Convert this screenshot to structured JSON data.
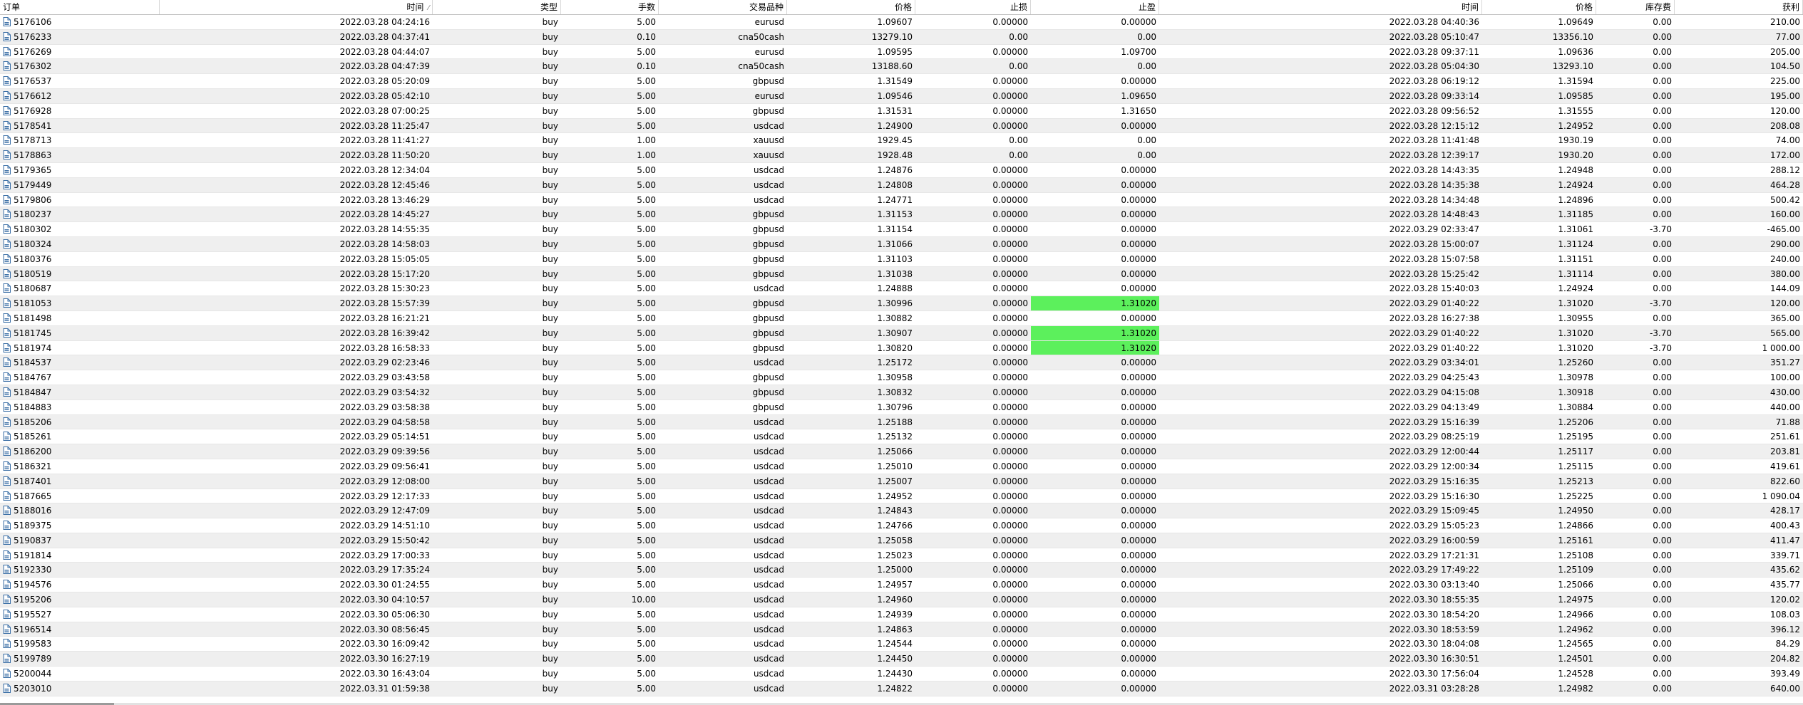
{
  "columns": {
    "order": "订单",
    "open_time": "时间",
    "type": "类型",
    "lots": "手数",
    "symbol": "交易品种",
    "open_price": "价格",
    "sl": "止损",
    "tp": "止盈",
    "close_time": "时间",
    "close_price": "价格",
    "swap": "库存费",
    "profit": "获利"
  },
  "icons": {
    "order_row": "document-icon",
    "sort": "sort-indicator-icon"
  },
  "colors": {
    "highlight": "#5cf05c",
    "row_alt": "#efefef"
  },
  "rows": [
    [
      "5176106",
      "2022.03.28 04:24:16",
      "buy",
      "5.00",
      "eurusd",
      "1.09607",
      "0.00000",
      "0.00000",
      "2022.03.28 04:40:36",
      "1.09649",
      "0.00",
      "210.00"
    ],
    [
      "5176233",
      "2022.03.28 04:37:41",
      "buy",
      "0.10",
      "cna50cash",
      "13279.10",
      "0.00",
      "0.00",
      "2022.03.28 05:10:47",
      "13356.10",
      "0.00",
      "77.00"
    ],
    [
      "5176269",
      "2022.03.28 04:44:07",
      "buy",
      "5.00",
      "eurusd",
      "1.09595",
      "0.00000",
      "1.09700",
      "2022.03.28 09:37:11",
      "1.09636",
      "0.00",
      "205.00"
    ],
    [
      "5176302",
      "2022.03.28 04:47:39",
      "buy",
      "0.10",
      "cna50cash",
      "13188.60",
      "0.00",
      "0.00",
      "2022.03.28 05:04:30",
      "13293.10",
      "0.00",
      "104.50"
    ],
    [
      "5176537",
      "2022.03.28 05:20:09",
      "buy",
      "5.00",
      "gbpusd",
      "1.31549",
      "0.00000",
      "0.00000",
      "2022.03.28 06:19:12",
      "1.31594",
      "0.00",
      "225.00"
    ],
    [
      "5176612",
      "2022.03.28 05:42:10",
      "buy",
      "5.00",
      "eurusd",
      "1.09546",
      "0.00000",
      "1.09650",
      "2022.03.28 09:33:14",
      "1.09585",
      "0.00",
      "195.00"
    ],
    [
      "5176928",
      "2022.03.28 07:00:25",
      "buy",
      "5.00",
      "gbpusd",
      "1.31531",
      "0.00000",
      "1.31650",
      "2022.03.28 09:56:52",
      "1.31555",
      "0.00",
      "120.00"
    ],
    [
      "5178541",
      "2022.03.28 11:25:47",
      "buy",
      "5.00",
      "usdcad",
      "1.24900",
      "0.00000",
      "0.00000",
      "2022.03.28 12:15:12",
      "1.24952",
      "0.00",
      "208.08"
    ],
    [
      "5178713",
      "2022.03.28 11:41:27",
      "buy",
      "1.00",
      "xauusd",
      "1929.45",
      "0.00",
      "0.00",
      "2022.03.28 11:41:48",
      "1930.19",
      "0.00",
      "74.00"
    ],
    [
      "5178863",
      "2022.03.28 11:50:20",
      "buy",
      "1.00",
      "xauusd",
      "1928.48",
      "0.00",
      "0.00",
      "2022.03.28 12:39:17",
      "1930.20",
      "0.00",
      "172.00"
    ],
    [
      "5179365",
      "2022.03.28 12:34:04",
      "buy",
      "5.00",
      "usdcad",
      "1.24876",
      "0.00000",
      "0.00000",
      "2022.03.28 14:43:35",
      "1.24948",
      "0.00",
      "288.12"
    ],
    [
      "5179449",
      "2022.03.28 12:45:46",
      "buy",
      "5.00",
      "usdcad",
      "1.24808",
      "0.00000",
      "0.00000",
      "2022.03.28 14:35:38",
      "1.24924",
      "0.00",
      "464.28"
    ],
    [
      "5179806",
      "2022.03.28 13:46:29",
      "buy",
      "5.00",
      "usdcad",
      "1.24771",
      "0.00000",
      "0.00000",
      "2022.03.28 14:34:48",
      "1.24896",
      "0.00",
      "500.42"
    ],
    [
      "5180237",
      "2022.03.28 14:45:27",
      "buy",
      "5.00",
      "gbpusd",
      "1.31153",
      "0.00000",
      "0.00000",
      "2022.03.28 14:48:43",
      "1.31185",
      "0.00",
      "160.00"
    ],
    [
      "5180302",
      "2022.03.28 14:55:35",
      "buy",
      "5.00",
      "gbpusd",
      "1.31154",
      "0.00000",
      "0.00000",
      "2022.03.29 02:33:47",
      "1.31061",
      "-3.70",
      "-465.00"
    ],
    [
      "5180324",
      "2022.03.28 14:58:03",
      "buy",
      "5.00",
      "gbpusd",
      "1.31066",
      "0.00000",
      "0.00000",
      "2022.03.28 15:00:07",
      "1.31124",
      "0.00",
      "290.00"
    ],
    [
      "5180376",
      "2022.03.28 15:05:05",
      "buy",
      "5.00",
      "gbpusd",
      "1.31103",
      "0.00000",
      "0.00000",
      "2022.03.28 15:07:58",
      "1.31151",
      "0.00",
      "240.00"
    ],
    [
      "5180519",
      "2022.03.28 15:17:20",
      "buy",
      "5.00",
      "gbpusd",
      "1.31038",
      "0.00000",
      "0.00000",
      "2022.03.28 15:25:42",
      "1.31114",
      "0.00",
      "380.00"
    ],
    [
      "5180687",
      "2022.03.28 15:30:23",
      "buy",
      "5.00",
      "usdcad",
      "1.24888",
      "0.00000",
      "0.00000",
      "2022.03.28 15:40:03",
      "1.24924",
      "0.00",
      "144.09"
    ],
    [
      "5181053",
      "2022.03.28 15:57:39",
      "buy",
      "5.00",
      "gbpusd",
      "1.30996",
      "0.00000",
      "1.31020",
      "2022.03.29 01:40:22",
      "1.31020",
      "-3.70",
      "120.00"
    ],
    [
      "5181498",
      "2022.03.28 16:21:21",
      "buy",
      "5.00",
      "gbpusd",
      "1.30882",
      "0.00000",
      "0.00000",
      "2022.03.28 16:27:38",
      "1.30955",
      "0.00",
      "365.00"
    ],
    [
      "5181745",
      "2022.03.28 16:39:42",
      "buy",
      "5.00",
      "gbpusd",
      "1.30907",
      "0.00000",
      "1.31020",
      "2022.03.29 01:40:22",
      "1.31020",
      "-3.70",
      "565.00"
    ],
    [
      "5181974",
      "2022.03.28 16:58:33",
      "buy",
      "5.00",
      "gbpusd",
      "1.30820",
      "0.00000",
      "1.31020",
      "2022.03.29 01:40:22",
      "1.31020",
      "-3.70",
      "1 000.00"
    ],
    [
      "5184537",
      "2022.03.29 02:23:46",
      "buy",
      "5.00",
      "usdcad",
      "1.25172",
      "0.00000",
      "0.00000",
      "2022.03.29 03:34:01",
      "1.25260",
      "0.00",
      "351.27"
    ],
    [
      "5184767",
      "2022.03.29 03:43:58",
      "buy",
      "5.00",
      "gbpusd",
      "1.30958",
      "0.00000",
      "0.00000",
      "2022.03.29 04:25:43",
      "1.30978",
      "0.00",
      "100.00"
    ],
    [
      "5184847",
      "2022.03.29 03:54:32",
      "buy",
      "5.00",
      "gbpusd",
      "1.30832",
      "0.00000",
      "0.00000",
      "2022.03.29 04:15:08",
      "1.30918",
      "0.00",
      "430.00"
    ],
    [
      "5184883",
      "2022.03.29 03:58:38",
      "buy",
      "5.00",
      "gbpusd",
      "1.30796",
      "0.00000",
      "0.00000",
      "2022.03.29 04:13:49",
      "1.30884",
      "0.00",
      "440.00"
    ],
    [
      "5185206",
      "2022.03.29 04:58:58",
      "buy",
      "5.00",
      "usdcad",
      "1.25188",
      "0.00000",
      "0.00000",
      "2022.03.29 15:16:39",
      "1.25206",
      "0.00",
      "71.88"
    ],
    [
      "5185261",
      "2022.03.29 05:14:51",
      "buy",
      "5.00",
      "usdcad",
      "1.25132",
      "0.00000",
      "0.00000",
      "2022.03.29 08:25:19",
      "1.25195",
      "0.00",
      "251.61"
    ],
    [
      "5186200",
      "2022.03.29 09:39:56",
      "buy",
      "5.00",
      "usdcad",
      "1.25066",
      "0.00000",
      "0.00000",
      "2022.03.29 12:00:44",
      "1.25117",
      "0.00",
      "203.81"
    ],
    [
      "5186321",
      "2022.03.29 09:56:41",
      "buy",
      "5.00",
      "usdcad",
      "1.25010",
      "0.00000",
      "0.00000",
      "2022.03.29 12:00:34",
      "1.25115",
      "0.00",
      "419.61"
    ],
    [
      "5187401",
      "2022.03.29 12:08:00",
      "buy",
      "5.00",
      "usdcad",
      "1.25007",
      "0.00000",
      "0.00000",
      "2022.03.29 15:16:35",
      "1.25213",
      "0.00",
      "822.60"
    ],
    [
      "5187665",
      "2022.03.29 12:17:33",
      "buy",
      "5.00",
      "usdcad",
      "1.24952",
      "0.00000",
      "0.00000",
      "2022.03.29 15:16:30",
      "1.25225",
      "0.00",
      "1 090.04"
    ],
    [
      "5188016",
      "2022.03.29 12:47:09",
      "buy",
      "5.00",
      "usdcad",
      "1.24843",
      "0.00000",
      "0.00000",
      "2022.03.29 15:09:45",
      "1.24950",
      "0.00",
      "428.17"
    ],
    [
      "5189375",
      "2022.03.29 14:51:10",
      "buy",
      "5.00",
      "usdcad",
      "1.24766",
      "0.00000",
      "0.00000",
      "2022.03.29 15:05:23",
      "1.24866",
      "0.00",
      "400.43"
    ],
    [
      "5190837",
      "2022.03.29 15:50:42",
      "buy",
      "5.00",
      "usdcad",
      "1.25058",
      "0.00000",
      "0.00000",
      "2022.03.29 16:00:59",
      "1.25161",
      "0.00",
      "411.47"
    ],
    [
      "5191814",
      "2022.03.29 17:00:33",
      "buy",
      "5.00",
      "usdcad",
      "1.25023",
      "0.00000",
      "0.00000",
      "2022.03.29 17:21:31",
      "1.25108",
      "0.00",
      "339.71"
    ],
    [
      "5192330",
      "2022.03.29 17:35:24",
      "buy",
      "5.00",
      "usdcad",
      "1.25000",
      "0.00000",
      "0.00000",
      "2022.03.29 17:49:22",
      "1.25109",
      "0.00",
      "435.62"
    ],
    [
      "5194576",
      "2022.03.30 01:24:55",
      "buy",
      "5.00",
      "usdcad",
      "1.24957",
      "0.00000",
      "0.00000",
      "2022.03.30 03:13:40",
      "1.25066",
      "0.00",
      "435.77"
    ],
    [
      "5195206",
      "2022.03.30 04:10:57",
      "buy",
      "10.00",
      "usdcad",
      "1.24960",
      "0.00000",
      "0.00000",
      "2022.03.30 18:55:35",
      "1.24975",
      "0.00",
      "120.02"
    ],
    [
      "5195527",
      "2022.03.30 05:06:30",
      "buy",
      "5.00",
      "usdcad",
      "1.24939",
      "0.00000",
      "0.00000",
      "2022.03.30 18:54:20",
      "1.24966",
      "0.00",
      "108.03"
    ],
    [
      "5196514",
      "2022.03.30 08:56:45",
      "buy",
      "5.00",
      "usdcad",
      "1.24863",
      "0.00000",
      "0.00000",
      "2022.03.30 18:53:59",
      "1.24962",
      "0.00",
      "396.12"
    ],
    [
      "5199583",
      "2022.03.30 16:09:42",
      "buy",
      "5.00",
      "usdcad",
      "1.24544",
      "0.00000",
      "0.00000",
      "2022.03.30 18:04:08",
      "1.24565",
      "0.00",
      "84.29"
    ],
    [
      "5199789",
      "2022.03.30 16:27:19",
      "buy",
      "5.00",
      "usdcad",
      "1.24450",
      "0.00000",
      "0.00000",
      "2022.03.30 16:30:51",
      "1.24501",
      "0.00",
      "204.82"
    ],
    [
      "5200044",
      "2022.03.30 16:43:04",
      "buy",
      "5.00",
      "usdcad",
      "1.24430",
      "0.00000",
      "0.00000",
      "2022.03.30 17:56:04",
      "1.24528",
      "0.00",
      "393.49"
    ],
    [
      "5203010",
      "2022.03.31 01:59:38",
      "buy",
      "5.00",
      "usdcad",
      "1.24822",
      "0.00000",
      "0.00000",
      "2022.03.31 03:28:28",
      "1.24982",
      "0.00",
      "640.00"
    ]
  ],
  "highlighted_tp_orders": [
    "5181053",
    "5181745",
    "5181974"
  ]
}
